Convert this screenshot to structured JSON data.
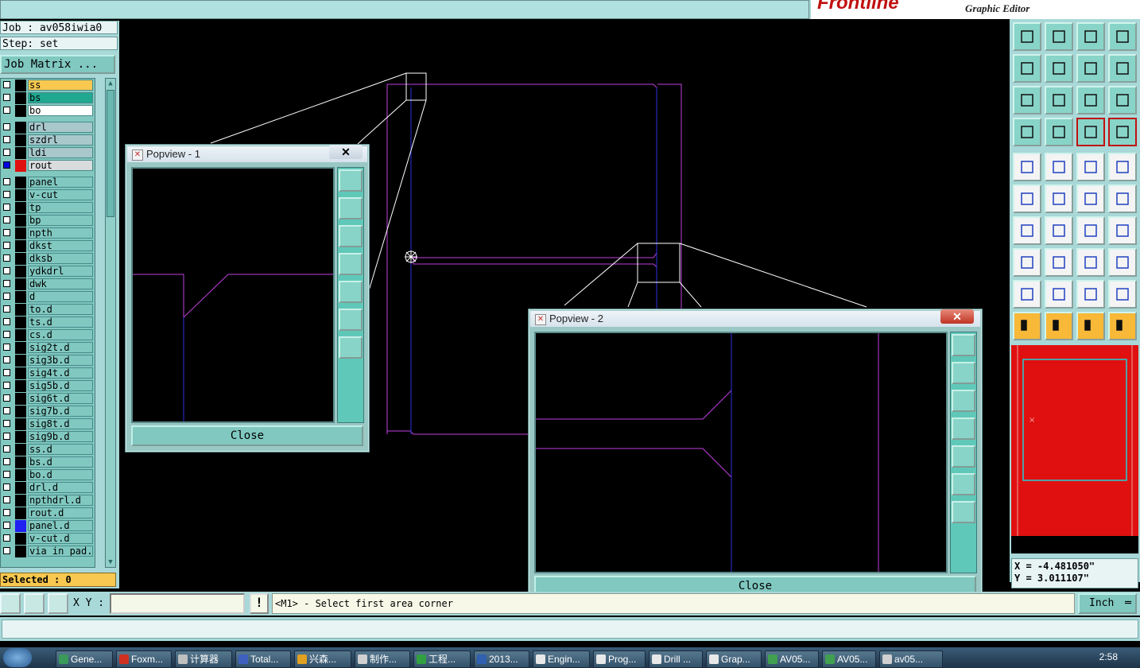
{
  "app": {
    "brand": "Frontline",
    "subtitle": "Graphic Editor"
  },
  "left": {
    "job_label": "Job : av058iwia0",
    "step_label": "Step: set",
    "job_matrix_label": "Job Matrix ...",
    "selected_label": "Selected : 0",
    "layers": [
      {
        "name": "ss",
        "color": "#f8c850",
        "active": false,
        "swatch": "#000"
      },
      {
        "name": "bs",
        "color": "#20a890",
        "active": false,
        "swatch": "#000"
      },
      {
        "name": "bo",
        "color": "#ffffff",
        "active": false,
        "swatch": "#000"
      },
      {
        "name": "drl",
        "color": "#a8c8cc",
        "active": false,
        "swatch": "#000"
      },
      {
        "name": "szdrl",
        "color": "#a8c8cc",
        "active": false,
        "swatch": "#000"
      },
      {
        "name": "ldi",
        "color": "#a8c8cc",
        "active": false,
        "swatch": "#000"
      },
      {
        "name": "rout",
        "color": "#d8dcdc",
        "active": true,
        "swatch": "#e01010"
      },
      {
        "name": "panel",
        "color": "#80c8c0",
        "active": false,
        "swatch": "#000"
      },
      {
        "name": "v-cut",
        "color": "#80c8c0",
        "active": false,
        "swatch": "#000"
      },
      {
        "name": "tp",
        "color": "#80c8c0",
        "active": false,
        "swatch": "#000"
      },
      {
        "name": "bp",
        "color": "#80c8c0",
        "active": false,
        "swatch": "#000"
      },
      {
        "name": "npth",
        "color": "#80c8c0",
        "active": false,
        "swatch": "#000"
      },
      {
        "name": "dkst",
        "color": "#80c8c0",
        "active": false,
        "swatch": "#000"
      },
      {
        "name": "dksb",
        "color": "#80c8c0",
        "active": false,
        "swatch": "#000"
      },
      {
        "name": "ydkdrl",
        "color": "#80c8c0",
        "active": false,
        "swatch": "#000"
      },
      {
        "name": "dwk",
        "color": "#80c8c0",
        "active": false,
        "swatch": "#000"
      },
      {
        "name": "d",
        "color": "#80c8c0",
        "active": false,
        "swatch": "#000"
      },
      {
        "name": "to.d",
        "color": "#80c8c0",
        "active": false,
        "swatch": "#000"
      },
      {
        "name": "ts.d",
        "color": "#80c8c0",
        "active": false,
        "swatch": "#000"
      },
      {
        "name": "cs.d",
        "color": "#80c8c0",
        "active": false,
        "swatch": "#000"
      },
      {
        "name": "sig2t.d",
        "color": "#80c8c0",
        "active": false,
        "swatch": "#000"
      },
      {
        "name": "sig3b.d",
        "color": "#80c8c0",
        "active": false,
        "swatch": "#000"
      },
      {
        "name": "sig4t.d",
        "color": "#80c8c0",
        "active": false,
        "swatch": "#000"
      },
      {
        "name": "sig5b.d",
        "color": "#80c8c0",
        "active": false,
        "swatch": "#000"
      },
      {
        "name": "sig6t.d",
        "color": "#80c8c0",
        "active": false,
        "swatch": "#000"
      },
      {
        "name": "sig7b.d",
        "color": "#80c8c0",
        "active": false,
        "swatch": "#000"
      },
      {
        "name": "sig8t.d",
        "color": "#80c8c0",
        "active": false,
        "swatch": "#000"
      },
      {
        "name": "sig9b.d",
        "color": "#80c8c0",
        "active": false,
        "swatch": "#000"
      },
      {
        "name": "ss.d",
        "color": "#80c8c0",
        "active": false,
        "swatch": "#000"
      },
      {
        "name": "bs.d",
        "color": "#80c8c0",
        "active": false,
        "swatch": "#000"
      },
      {
        "name": "bo.d",
        "color": "#80c8c0",
        "active": false,
        "swatch": "#000"
      },
      {
        "name": "drl.d",
        "color": "#80c8c0",
        "active": false,
        "swatch": "#000"
      },
      {
        "name": "npthdrl.d",
        "color": "#80c8c0",
        "active": false,
        "swatch": "#000"
      },
      {
        "name": "rout.d",
        "color": "#80c8c0",
        "active": false,
        "swatch": "#000"
      },
      {
        "name": "panel.d",
        "color": "#80c8c0",
        "active": false,
        "swatch": "#2020f0"
      },
      {
        "name": "v-cut.d",
        "color": "#80c8c0",
        "active": false,
        "swatch": "#000"
      },
      {
        "name": "via_in_pad.d",
        "color": "#80c8c0",
        "active": false,
        "swatch": "#000"
      }
    ]
  },
  "popview1": {
    "title": "Popview - 1",
    "close_label": "Close"
  },
  "popview2": {
    "title": "Popview - 2",
    "close_label": "Close"
  },
  "coords": {
    "x": "X = -4.481050\"",
    "y": "Y = 3.011107\""
  },
  "bottom": {
    "xy_label": "X Y :",
    "xy_value": "",
    "prompt": "<M1> - Select first area corner",
    "units": "Inch"
  },
  "taskbar": {
    "clock": "2:58",
    "items": [
      {
        "label": "Gene...",
        "icon": "#3a9a5a"
      },
      {
        "label": "Foxm...",
        "icon": "#d03020"
      },
      {
        "label": "计算器",
        "icon": "#c0c0c0"
      },
      {
        "label": "Total...",
        "icon": "#4060c0"
      },
      {
        "label": "兴森...",
        "icon": "#e0a020"
      },
      {
        "label": "制作...",
        "icon": "#d0d0d0"
      },
      {
        "label": "工程...",
        "icon": "#30a040"
      },
      {
        "label": "2013...",
        "icon": "#3060b0"
      },
      {
        "label": "Engin...",
        "icon": "#e8e8e8"
      },
      {
        "label": "Prog...",
        "icon": "#e8e8e8"
      },
      {
        "label": "Drill ...",
        "icon": "#e8e8e8"
      },
      {
        "label": "Grap...",
        "icon": "#e8e8e8"
      },
      {
        "label": "AV05...",
        "icon": "#40a050"
      },
      {
        "label": "AV05...",
        "icon": "#40a050"
      },
      {
        "label": "av05...",
        "icon": "#d0d0d0"
      }
    ]
  },
  "colors": {
    "board_outline": "#c040e0",
    "drill_line": "#3030e0",
    "zoom_box": "#ffffff",
    "mini_bg": "#e01010",
    "mini_outline": "#20d0d8"
  }
}
